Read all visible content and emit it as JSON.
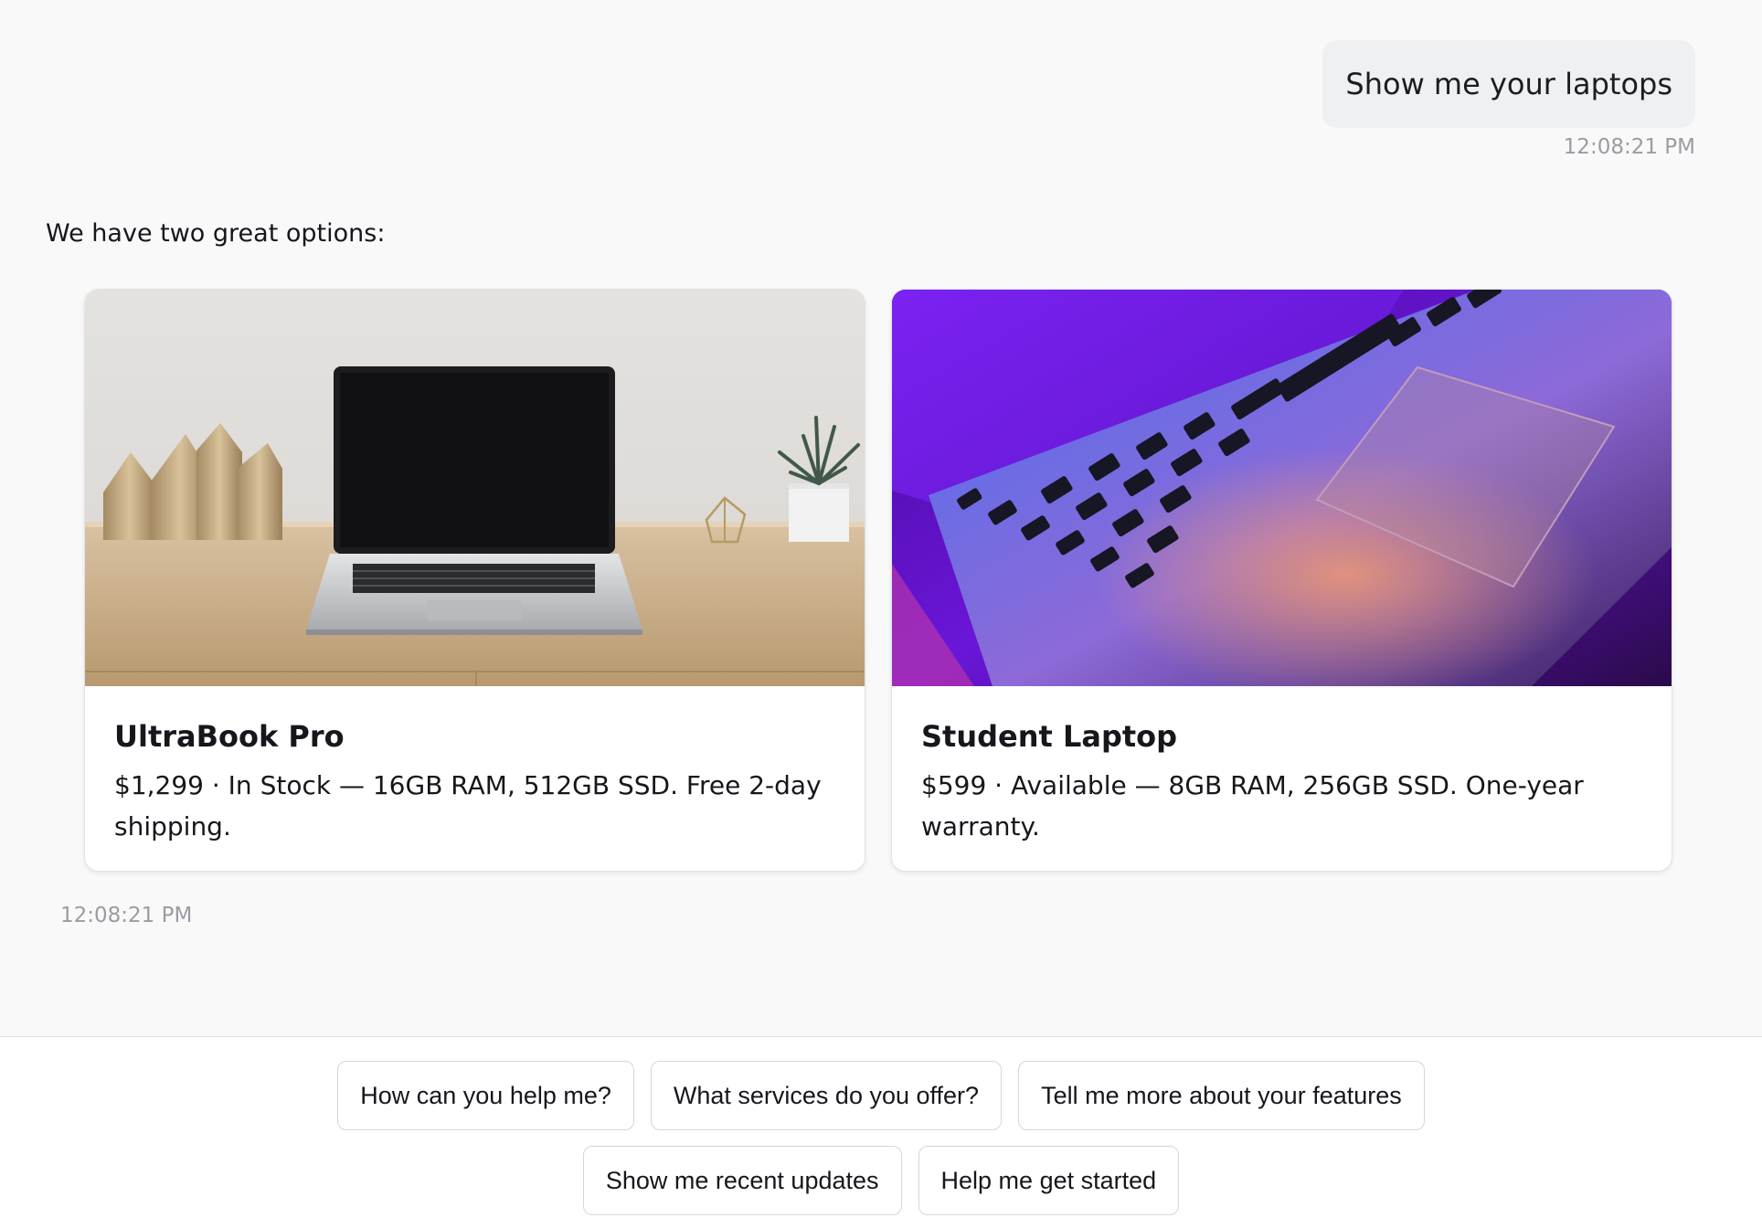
{
  "user_message": {
    "text": "Show me your laptops",
    "timestamp": "12:08:21 PM"
  },
  "bot_message": {
    "text": "We have two great options:",
    "timestamp": "12:08:21 PM",
    "products": [
      {
        "title": "UltraBook Pro",
        "description": "$1,299 · In Stock — 16GB RAM, 512GB SSD. Free 2-day shipping.",
        "image": "laptop-on-desk-photo"
      },
      {
        "title": "Student Laptop",
        "description": "$599 · Available — 8GB RAM, 256GB SSD. One-year warranty.",
        "image": "purple-laptop-keyboard-photo"
      }
    ]
  },
  "suggestions": [
    "How can you help me?",
    "What services do you offer?",
    "Tell me more about your features",
    "Show me recent updates",
    "Help me get started"
  ]
}
